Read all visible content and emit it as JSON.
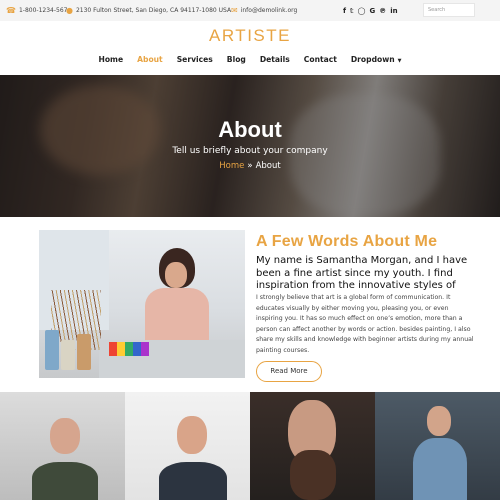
{
  "topbar": {
    "phone": "1-800-1234-567",
    "address": "2130 Fulton Street, San Diego, CA 94117-1080 USA",
    "email": "info@demolink.org",
    "social_icons": [
      "facebook-icon",
      "twitter-icon",
      "instagram-icon",
      "google-plus-icon",
      "pinterest-icon",
      "linkedin-icon"
    ],
    "search_placeholder": "Search"
  },
  "header": {
    "logo": "ARTISTE",
    "nav": [
      {
        "label": "Home",
        "active": false
      },
      {
        "label": "About",
        "active": true
      },
      {
        "label": "Services",
        "active": false
      },
      {
        "label": "Blog",
        "active": false
      },
      {
        "label": "Details",
        "active": false
      },
      {
        "label": "Contact",
        "active": false
      },
      {
        "label": "Dropdown",
        "active": false
      }
    ]
  },
  "hero": {
    "title": "About",
    "subtitle": "Tell us briefly about your company",
    "breadcrumb": {
      "home": "Home",
      "separator": "»",
      "current": "About"
    }
  },
  "about": {
    "heading": "A Few Words About Me",
    "lead": "My name is Samantha Morgan, and I have been a fine artist since my youth. I find inspiration from the innovative styles of",
    "body": "I strongly believe that art is a global form of communication. It educates visually by either moving you, pleasing you, or even inspiring you. It has so much effect on one’s emotion, more than a person can affect another by words or action. besides painting, I also share my skills and knowledge with beginner artists during my annual painting courses.",
    "button": "Read More"
  },
  "colors": {
    "accent": "#e8a443",
    "topbar_bg": "#f4f4f4",
    "text_dark": "#222222"
  }
}
